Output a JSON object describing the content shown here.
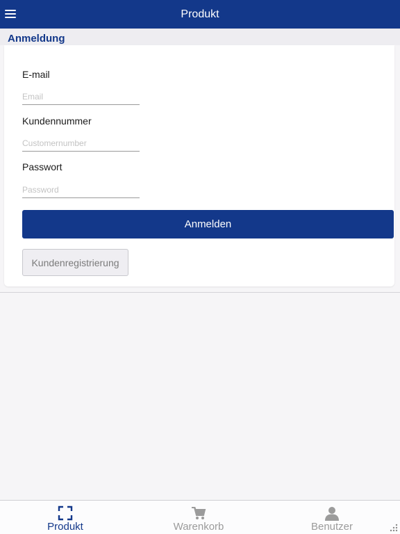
{
  "header": {
    "title": "Produkt"
  },
  "section": {
    "title": "Anmeldung"
  },
  "form": {
    "email": {
      "label": "E-mail",
      "placeholder": "Email",
      "value": ""
    },
    "customer_number": {
      "label": "Kundennummer",
      "placeholder": "Customernumber",
      "value": ""
    },
    "password": {
      "label": "Passwort",
      "placeholder": "Password",
      "value": ""
    },
    "login_label": "Anmelden",
    "register_label": "Kundenregistrierung"
  },
  "tabs": [
    {
      "label": "Produkt",
      "icon": "scan-frame-icon",
      "active": true
    },
    {
      "label": "Warenkorb",
      "icon": "cart-icon",
      "active": false
    },
    {
      "label": "Benutzer",
      "icon": "user-icon",
      "active": false
    }
  ],
  "colors": {
    "primary": "#13388a",
    "tab_active": "#13388a",
    "tab_inactive": "#9b9b9b"
  }
}
